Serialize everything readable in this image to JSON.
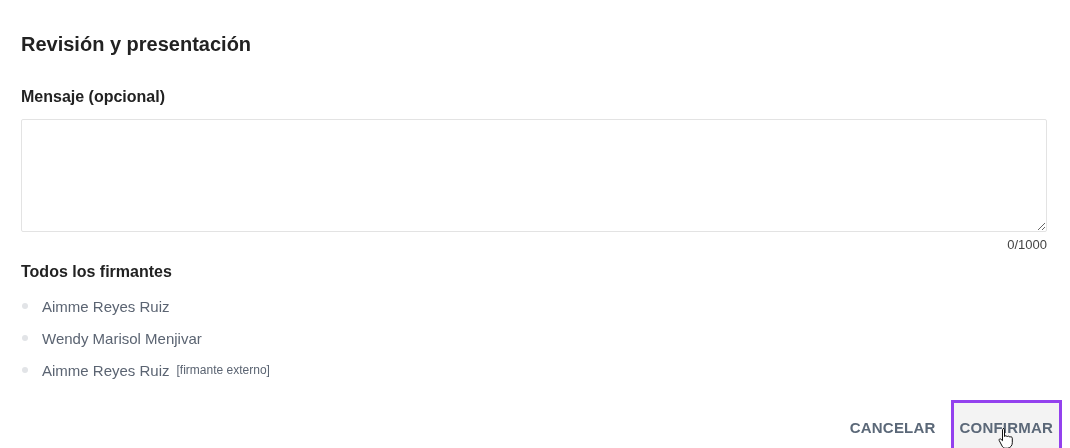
{
  "title": "Revisión y presentación",
  "message": {
    "label": "Mensaje (opcional)",
    "counter": "0/1000"
  },
  "signers": {
    "heading": "Todos los firmantes",
    "items": [
      {
        "name": "Aimme Reyes Ruiz"
      },
      {
        "name": "Wendy Marisol Menjivar"
      },
      {
        "name": "Aimme Reyes Ruiz",
        "tag": "[firmante externo]"
      }
    ]
  },
  "buttons": [
    {
      "label": "CANCELAR",
      "focused": false
    },
    {
      "label": "CONFIRMAR",
      "focused": true
    }
  ]
}
